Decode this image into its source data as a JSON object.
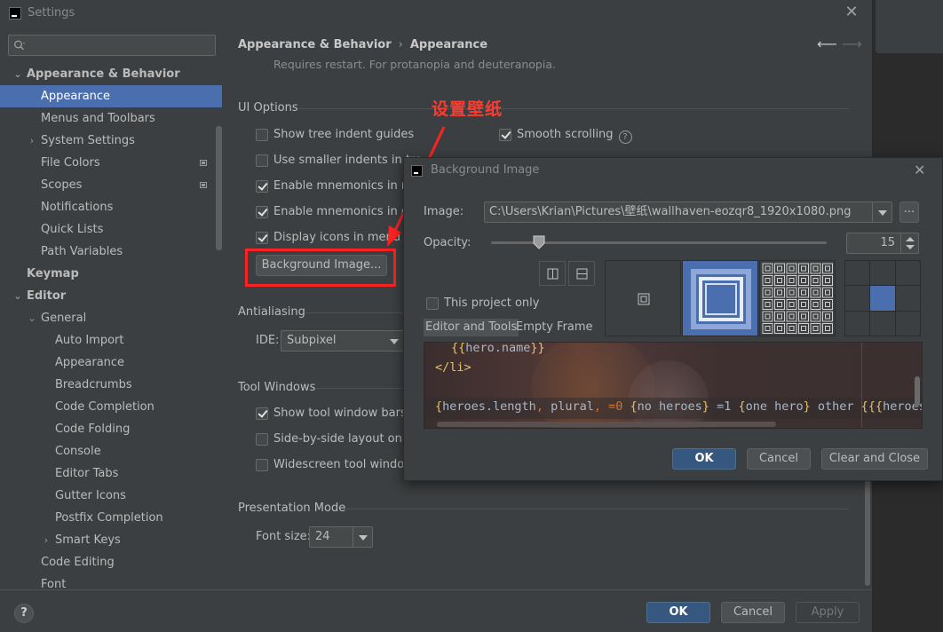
{
  "window": {
    "title": "Settings"
  },
  "search": {
    "placeholder": ""
  },
  "sidebar": {
    "items": [
      {
        "label": "Appearance & Behavior"
      },
      {
        "label": "Appearance"
      },
      {
        "label": "Menus and Toolbars"
      },
      {
        "label": "System Settings"
      },
      {
        "label": "File Colors"
      },
      {
        "label": "Scopes"
      },
      {
        "label": "Notifications"
      },
      {
        "label": "Quick Lists"
      },
      {
        "label": "Path Variables"
      },
      {
        "label": "Keymap"
      },
      {
        "label": "Editor"
      },
      {
        "label": "General"
      },
      {
        "label": "Auto Import"
      },
      {
        "label": "Appearance"
      },
      {
        "label": "Breadcrumbs"
      },
      {
        "label": "Code Completion"
      },
      {
        "label": "Code Folding"
      },
      {
        "label": "Console"
      },
      {
        "label": "Editor Tabs"
      },
      {
        "label": "Gutter Icons"
      },
      {
        "label": "Postfix Completion"
      },
      {
        "label": "Smart Keys"
      },
      {
        "label": "Code Editing"
      },
      {
        "label": "Font"
      }
    ]
  },
  "breadcrumb": {
    "parent": "Appearance & Behavior",
    "separator": "›",
    "current": "Appearance"
  },
  "content": {
    "hint": "Requires restart. For protanopia and deuteranopia.",
    "ui_options": {
      "title": "UI Options",
      "left": [
        {
          "label": "Show tree indent guides",
          "checked": false
        },
        {
          "label": "Use smaller indents in tre",
          "checked": false
        },
        {
          "label": "Enable mnemonics in me",
          "checked": true
        },
        {
          "label": "Enable mnemonics in cor",
          "checked": true
        },
        {
          "label": "Display icons in menu iter",
          "checked": true
        }
      ],
      "right": [
        {
          "label": "Smooth scrolling",
          "checked": true
        }
      ],
      "background_button": "Background Image..."
    },
    "antialiasing": {
      "title": "Antialiasing",
      "ide_label": "IDE:",
      "ide_value": "Subpixel"
    },
    "tool_windows": {
      "title": "Tool Windows",
      "items": [
        {
          "label": "Show tool window bars",
          "checked": true
        },
        {
          "label": "Side-by-side layout on th",
          "checked": false
        },
        {
          "label": "Widescreen tool window",
          "checked": false
        }
      ]
    },
    "presentation": {
      "title": "Presentation Mode",
      "font_label": "Font size:",
      "font_value": "24"
    }
  },
  "footer": {
    "help": "?",
    "ok": "OK",
    "cancel": "Cancel",
    "apply": "Apply"
  },
  "annotation": {
    "text": "设置壁纸",
    "color": "#ff2222"
  },
  "dialog": {
    "title": "Background Image",
    "image_label": "Image:",
    "image_path": "C:\\Users\\Krian\\Pictures\\壁纸\\wallhaven-eozqr8_1920x1080.png",
    "browse": "...",
    "opacity_label": "Opacity:",
    "opacity_value": "15",
    "opacity": 15,
    "this_project_only": "This project only",
    "tabs": [
      "Editor and Tools",
      "Empty Frame"
    ],
    "code": {
      "line1_open": "{{",
      "line1_var": "hero.name",
      "line1_close": "}}",
      "line2": "</li>",
      "line3_a": "{",
      "line3_b": "heroes.length",
      "line3_c": ", ",
      "line3_d": "plural",
      "line3_e": ", =0 ",
      "line3_f": "{",
      "line3_g": "no heroes",
      "line3_h": "}",
      "line3_i": " =1 ",
      "line3_j": "{",
      "line3_k": "one hero",
      "line3_l": "}",
      "line3_m": " other ",
      "line3_n": "{{{",
      "line3_o": "heroes."
    },
    "ok": "OK",
    "cancel": "Cancel",
    "clear_close": "Clear and Close"
  }
}
